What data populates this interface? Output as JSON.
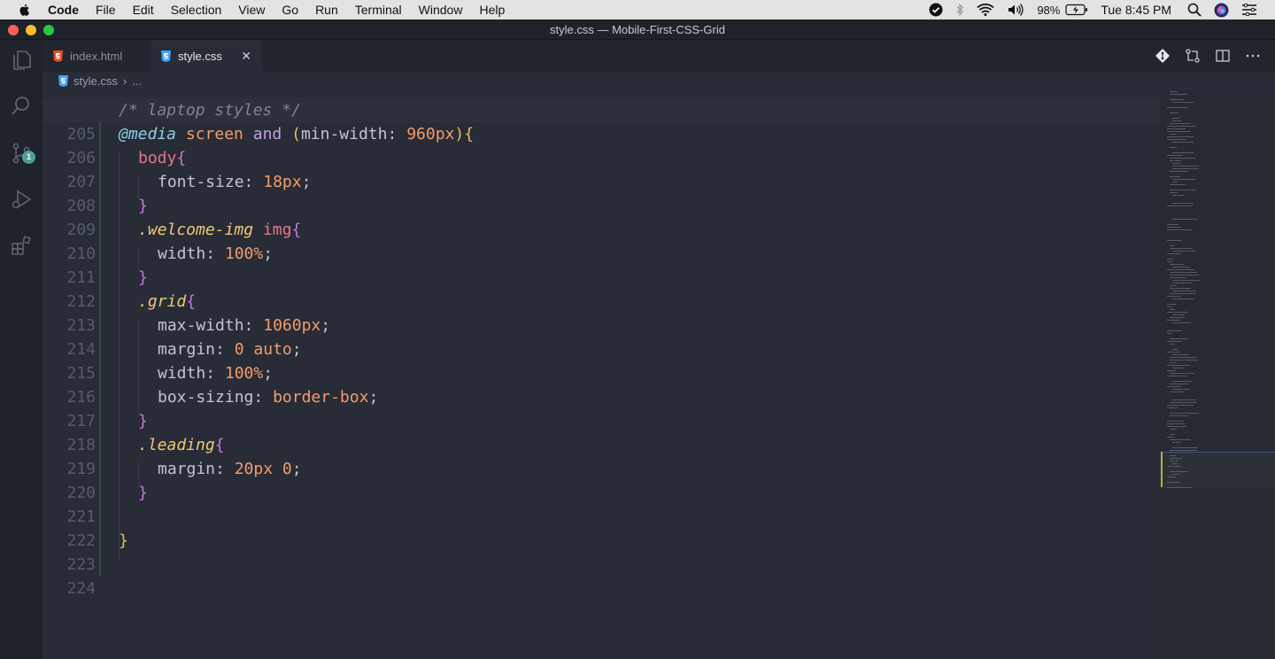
{
  "menubar": {
    "items": [
      "Code",
      "File",
      "Edit",
      "Selection",
      "View",
      "Go",
      "Run",
      "Terminal",
      "Window",
      "Help"
    ],
    "battery": "98%",
    "clock": "Tue 8:45 PM"
  },
  "window": {
    "title": "style.css — Mobile-First-CSS-Grid"
  },
  "activity": {
    "source_control_badge": "1"
  },
  "tabs": [
    {
      "label": "index.html",
      "icon": "html5-icon",
      "active": false
    },
    {
      "label": "style.css",
      "icon": "css3-icon",
      "active": true,
      "close": "✕"
    }
  ],
  "breadcrumbs": {
    "file": "style.css",
    "separator": "›",
    "rest": "..."
  },
  "code": {
    "lines": [
      {
        "num": "205"
      },
      {
        "num": "206"
      },
      {
        "num": "207"
      },
      {
        "num": "208"
      },
      {
        "num": "209"
      },
      {
        "num": "210"
      },
      {
        "num": "211"
      },
      {
        "num": "212"
      },
      {
        "num": "213"
      },
      {
        "num": "214"
      },
      {
        "num": "215"
      },
      {
        "num": "216"
      },
      {
        "num": "217"
      },
      {
        "num": "218"
      },
      {
        "num": "219"
      },
      {
        "num": "220"
      },
      {
        "num": "221"
      },
      {
        "num": "222"
      },
      {
        "num": "223"
      },
      {
        "num": "224"
      }
    ],
    "tokens": {
      "l205_comment": "/* laptop styles */",
      "l206_at": "@media",
      "l206_screen": "screen",
      "l206_and": "and",
      "l206_open": "(",
      "l206_prop": "min-width",
      "l206_colon": ": ",
      "l206_val": "960px",
      "l206_close": "){",
      "l207_sel": "body",
      "l207_brace": "{",
      "l208_prop": "font-size",
      "l208_colon": ": ",
      "l208_val": "18px",
      "l208_semi": ";",
      "l209_brace": "}",
      "l210_cls": ".welcome-img",
      "l210_sel": "img",
      "l210_brace": "{",
      "l211_prop": "width",
      "l211_colon": ": ",
      "l211_val": "100%",
      "l211_semi": ";",
      "l212_brace": "}",
      "l213_cls": ".grid",
      "l213_brace": "{",
      "l214_prop": "max-width",
      "l214_colon": ": ",
      "l214_val": "1060px",
      "l214_semi": ";",
      "l215_prop": "margin",
      "l215_colon": ": ",
      "l215_val": "0 auto",
      "l215_semi": ";",
      "l216_prop": "width",
      "l216_colon": ": ",
      "l216_val": "100%",
      "l216_semi": ";",
      "l217_prop": "box-sizing",
      "l217_colon": ": ",
      "l217_val": "border-box",
      "l217_semi": ";",
      "l218_brace": "}",
      "l219_cls": ".leading",
      "l219_brace": "{",
      "l220_prop": "margin",
      "l220_colon": ": ",
      "l220_val": "20px 0",
      "l220_semi": ";",
      "l221_brace": "}",
      "l223_brace": "}"
    }
  },
  "colors": {
    "editor_bg": "#272c36",
    "comment": "#7d8592",
    "at_rule": "#8fd0e6",
    "keyword": "#f59b6c",
    "selector": "#e57689",
    "class": "#f2c777",
    "brace": "#c678dd",
    "badge": "#4e9e96"
  }
}
